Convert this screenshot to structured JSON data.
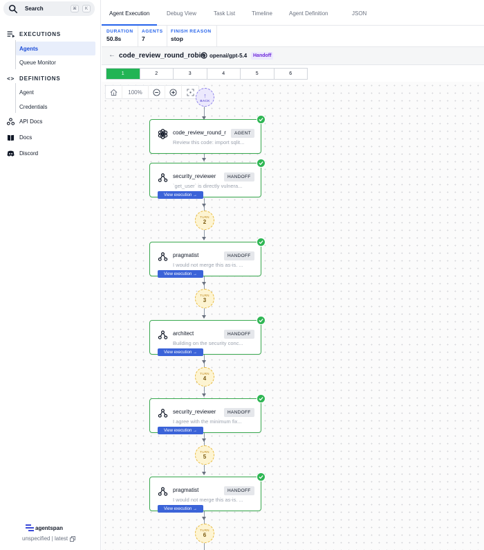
{
  "sidebar": {
    "search": {
      "label": "Search",
      "kbd": [
        "⌘",
        "K"
      ]
    },
    "executions": {
      "title": "EXECUTIONS",
      "items": [
        {
          "label": "Agents",
          "active": true
        },
        {
          "label": "Queue Monitor"
        }
      ]
    },
    "definitions": {
      "title": "DEFINITIONS",
      "items": [
        {
          "label": "Agent"
        },
        {
          "label": "Credentials"
        }
      ]
    },
    "links": [
      {
        "label": "API Docs"
      },
      {
        "label": "Docs"
      },
      {
        "label": "Discord"
      }
    ],
    "brand": "agentspan",
    "version": "unspecified | latest"
  },
  "tabs": [
    "Agent Execution",
    "Debug View",
    "Task List",
    "Timeline",
    "Agent Definition",
    "JSON"
  ],
  "stats": [
    {
      "label": "DURATION",
      "value": "50.8s"
    },
    {
      "label": "AGENTS",
      "value": "7"
    },
    {
      "label": "FINISH REASON",
      "value": "stop"
    }
  ],
  "run": {
    "name": "code_review_round_robin",
    "model": "openai/gpt-5.4",
    "strategy": "Handoff"
  },
  "turn_tabs": [
    "1",
    "2",
    "3",
    "4",
    "5",
    "6"
  ],
  "toolbar": {
    "zoom": "100%"
  },
  "graph": {
    "back_label": "BACK",
    "turn_label": "TURN",
    "view_label": "View execution →",
    "root": {
      "name": "code_review_round_r",
      "type": "AGENT",
      "preview": "Review this code: import sqlit..."
    },
    "nodes": [
      {
        "name": "security_reviewer",
        "type": "HANDOFF",
        "preview": "`get_user` is directly vulnera..."
      },
      {
        "name": "pragmatist",
        "type": "HANDOFF",
        "preview": "I would not merge this as-is. ..."
      },
      {
        "name": "architect",
        "type": "HANDOFF",
        "preview": "Building on the security conc..."
      },
      {
        "name": "security_reviewer",
        "type": "HANDOFF",
        "preview": "I agree with the minimum fix..."
      },
      {
        "name": "pragmatist",
        "type": "HANDOFF",
        "preview": "I would not merge this as-is. ..."
      }
    ],
    "turns": [
      "2",
      "3",
      "4",
      "5",
      "6"
    ]
  },
  "colors": {
    "accent": "#2563eb",
    "success": "#22b455",
    "handoff": "#6d28d9",
    "turn": "#e8b93a"
  }
}
